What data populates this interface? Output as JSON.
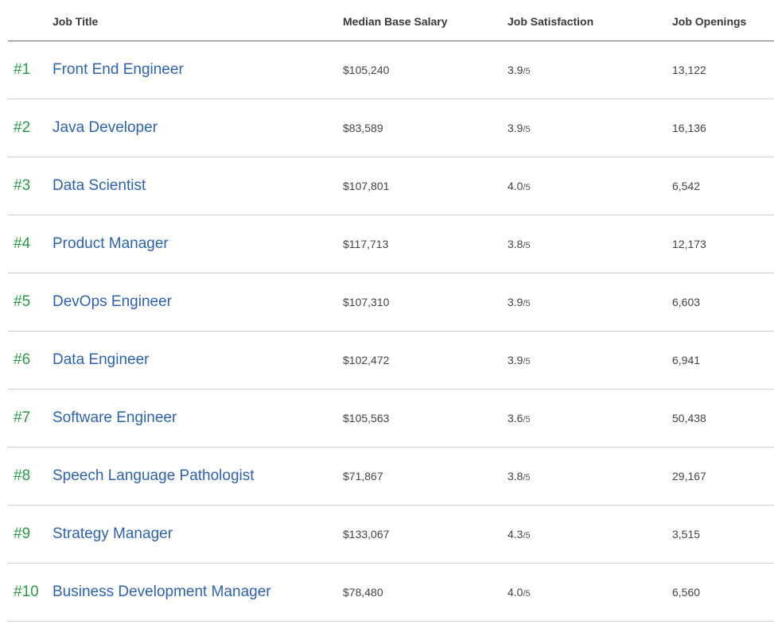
{
  "headers": {
    "job_title": "Job Title",
    "salary": "Median Base Salary",
    "satisfaction": "Job Satisfaction",
    "openings": "Job Openings"
  },
  "rows": [
    {
      "rank": "#1",
      "title": "Front End Engineer",
      "salary": "$105,240",
      "satisfaction": "3.9",
      "denom": "/5",
      "openings": "13,122"
    },
    {
      "rank": "#2",
      "title": "Java Developer",
      "salary": "$83,589",
      "satisfaction": "3.9",
      "denom": "/5",
      "openings": "16,136"
    },
    {
      "rank": "#3",
      "title": "Data Scientist",
      "salary": "$107,801",
      "satisfaction": "4.0",
      "denom": "/5",
      "openings": "6,542"
    },
    {
      "rank": "#4",
      "title": "Product Manager",
      "salary": "$117,713",
      "satisfaction": "3.8",
      "denom": "/5",
      "openings": "12,173"
    },
    {
      "rank": "#5",
      "title": "DevOps Engineer",
      "salary": "$107,310",
      "satisfaction": "3.9",
      "denom": "/5",
      "openings": "6,603"
    },
    {
      "rank": "#6",
      "title": "Data Engineer",
      "salary": "$102,472",
      "satisfaction": "3.9",
      "denom": "/5",
      "openings": "6,941"
    },
    {
      "rank": "#7",
      "title": "Software Engineer",
      "salary": "$105,563",
      "satisfaction": "3.6",
      "denom": "/5",
      "openings": "50,438"
    },
    {
      "rank": "#8",
      "title": "Speech Language Pathologist",
      "salary": "$71,867",
      "satisfaction": "3.8",
      "denom": "/5",
      "openings": "29,167"
    },
    {
      "rank": "#9",
      "title": "Strategy Manager",
      "salary": "$133,067",
      "satisfaction": "4.3",
      "denom": "/5",
      "openings": "3,515"
    },
    {
      "rank": "#10",
      "title": "Business Development Manager",
      "salary": "$78,480",
      "satisfaction": "4.0",
      "denom": "/5",
      "openings": "6,560"
    }
  ],
  "colors": {
    "rank": "#2b9a47",
    "title_link": "#2f62ad",
    "header_rule": "#6e6e6e",
    "row_rule": "#cfcfcf"
  }
}
